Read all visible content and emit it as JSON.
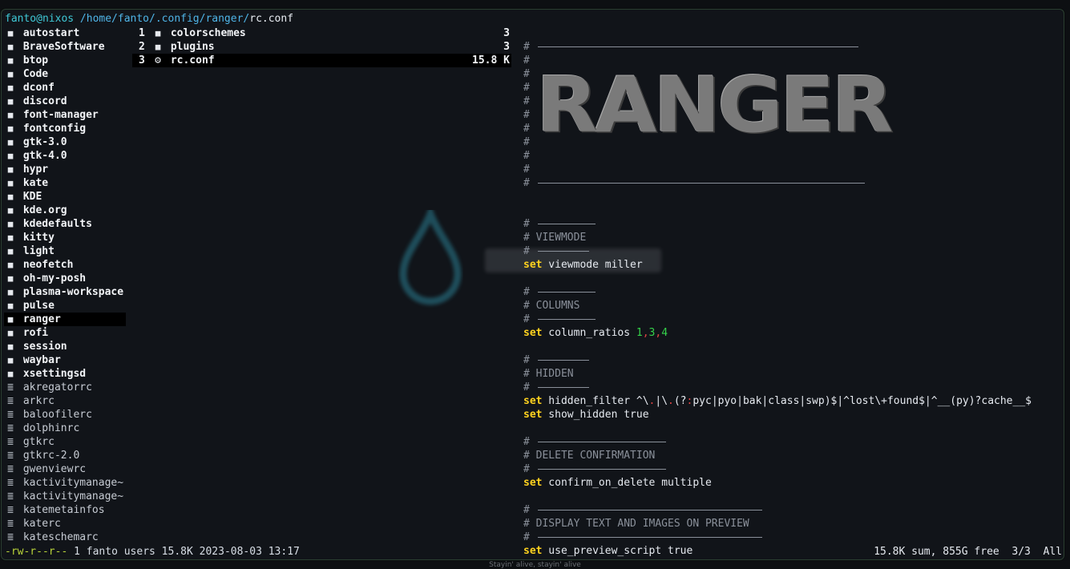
{
  "titlebar": {
    "user_host": "fanto@nixos",
    "path": " /home/fanto/.config/ranger/",
    "file": "rc.conf"
  },
  "parent_column": [
    {
      "type": "dir",
      "name": "autostart"
    },
    {
      "type": "dir",
      "name": "BraveSoftware"
    },
    {
      "type": "dir",
      "name": "btop"
    },
    {
      "type": "dir",
      "name": "Code"
    },
    {
      "type": "dir",
      "name": "dconf"
    },
    {
      "type": "dir",
      "name": "discord"
    },
    {
      "type": "dir",
      "name": "font-manager"
    },
    {
      "type": "dir",
      "name": "fontconfig"
    },
    {
      "type": "dir",
      "name": "gtk-3.0"
    },
    {
      "type": "dir",
      "name": "gtk-4.0"
    },
    {
      "type": "dir",
      "name": "hypr"
    },
    {
      "type": "dir",
      "name": "kate"
    },
    {
      "type": "dir",
      "name": "KDE"
    },
    {
      "type": "dir",
      "name": "kde.org"
    },
    {
      "type": "dir",
      "name": "kdedefaults"
    },
    {
      "type": "dir",
      "name": "kitty"
    },
    {
      "type": "dir",
      "name": "light"
    },
    {
      "type": "dir",
      "name": "neofetch"
    },
    {
      "type": "dir",
      "name": "oh-my-posh"
    },
    {
      "type": "dir",
      "name": "plasma-workspace"
    },
    {
      "type": "dir",
      "name": "pulse"
    },
    {
      "type": "dir",
      "name": "ranger",
      "selected": true
    },
    {
      "type": "dir",
      "name": "rofi"
    },
    {
      "type": "dir",
      "name": "session"
    },
    {
      "type": "dir",
      "name": "waybar"
    },
    {
      "type": "dir",
      "name": "xsettingsd"
    },
    {
      "type": "file",
      "name": "akregatorrc"
    },
    {
      "type": "file",
      "name": "arkrc"
    },
    {
      "type": "file",
      "name": "baloofilerc"
    },
    {
      "type": "file",
      "name": "dolphinrc"
    },
    {
      "type": "file",
      "name": "gtkrc"
    },
    {
      "type": "file",
      "name": "gtkrc-2.0"
    },
    {
      "type": "file",
      "name": "gwenviewrc"
    },
    {
      "type": "file",
      "name": "kactivitymanage~"
    },
    {
      "type": "file",
      "name": "kactivitymanage~"
    },
    {
      "type": "file",
      "name": "katemetainfos"
    },
    {
      "type": "file",
      "name": "katerc"
    },
    {
      "type": "file",
      "name": "kateschemarc"
    }
  ],
  "current_column": [
    {
      "num": "1",
      "type": "dir",
      "name": "colorschemes",
      "size": "3"
    },
    {
      "num": "2",
      "type": "dir",
      "name": "plugins",
      "size": "3"
    },
    {
      "num": "3",
      "type": "conf",
      "name": "rc.conf",
      "size": "15.8 K",
      "selected": true
    }
  ],
  "icons": {
    "dir": "folder-icon",
    "file": "text-file-icon",
    "conf": "gear-icon"
  },
  "preview": {
    "banner": "RANGER",
    "lines": [
      {
        "segments": [
          {
            "c": "cm",
            "t": "# "
          }
        ]
      },
      {
        "segments": [
          {
            "c": "cm",
            "t": "#"
          }
        ]
      },
      {
        "segments": [
          {
            "c": "cm",
            "t": "#"
          }
        ]
      },
      {
        "segments": [
          {
            "c": "cm",
            "t": "#"
          }
        ]
      },
      {
        "segments": [
          {
            "c": "cm",
            "t": "#"
          }
        ]
      },
      {
        "segments": [
          {
            "c": "cm",
            "t": "#"
          }
        ]
      },
      {
        "segments": [
          {
            "c": "cm",
            "t": "#"
          }
        ]
      },
      {
        "segments": [
          {
            "c": "cm",
            "t": "#"
          }
        ]
      },
      {
        "segments": [
          {
            "c": "cm",
            "t": "#"
          }
        ]
      },
      {
        "segments": [
          {
            "c": "cm",
            "t": "#"
          }
        ]
      },
      {
        "segments": [
          {
            "c": "cm",
            "t": "# "
          }
        ]
      },
      {
        "segments": []
      },
      {
        "segments": []
      },
      {
        "segments": [
          {
            "c": "cm",
            "t": "# "
          }
        ]
      },
      {
        "segments": [
          {
            "c": "cm",
            "t": "# VIEWMODE"
          }
        ]
      },
      {
        "segments": [
          {
            "c": "cm",
            "t": "# "
          }
        ]
      },
      {
        "segments": [
          {
            "c": "kw",
            "t": "set"
          },
          {
            "c": "tx",
            "t": " viewmode miller"
          }
        ]
      },
      {
        "segments": []
      },
      {
        "segments": [
          {
            "c": "cm",
            "t": "# "
          }
        ]
      },
      {
        "segments": [
          {
            "c": "cm",
            "t": "# COLUMNS"
          }
        ]
      },
      {
        "segments": [
          {
            "c": "cm",
            "t": "# "
          }
        ]
      },
      {
        "segments": [
          {
            "c": "kw",
            "t": "set"
          },
          {
            "c": "tx",
            "t": " column_ratios "
          },
          {
            "c": "gn",
            "t": "1"
          },
          {
            "c": "rd",
            "t": ","
          },
          {
            "c": "gn",
            "t": "3"
          },
          {
            "c": "rd",
            "t": ","
          },
          {
            "c": "gn",
            "t": "4"
          }
        ]
      },
      {
        "segments": []
      },
      {
        "segments": [
          {
            "c": "cm",
            "t": "# "
          }
        ]
      },
      {
        "segments": [
          {
            "c": "cm",
            "t": "# HIDDEN"
          }
        ]
      },
      {
        "segments": [
          {
            "c": "cm",
            "t": "# "
          }
        ]
      },
      {
        "segments": [
          {
            "c": "kw",
            "t": "set"
          },
          {
            "c": "tx",
            "t": " hidden_filter ^\\"
          },
          {
            "c": "pk",
            "t": "."
          },
          {
            "c": "tx",
            "t": "|\\"
          },
          {
            "c": "pk",
            "t": "."
          },
          {
            "c": "tx",
            "t": "(?"
          },
          {
            "c": "pk",
            "t": ":"
          },
          {
            "c": "tx",
            "t": "pyc|pyo|bak|class|swp)$|^lost\\+found$|^__(py)?cache__$"
          }
        ]
      },
      {
        "segments": [
          {
            "c": "kw",
            "t": "set"
          },
          {
            "c": "tx",
            "t": " show_hidden true"
          }
        ]
      },
      {
        "segments": []
      },
      {
        "segments": [
          {
            "c": "cm",
            "t": "# "
          }
        ]
      },
      {
        "segments": [
          {
            "c": "cm",
            "t": "# DELETE CONFIRMATION"
          }
        ]
      },
      {
        "segments": [
          {
            "c": "cm",
            "t": "# "
          }
        ]
      },
      {
        "segments": [
          {
            "c": "kw",
            "t": "set"
          },
          {
            "c": "tx",
            "t": " confirm_on_delete multiple"
          }
        ]
      },
      {
        "segments": []
      },
      {
        "segments": [
          {
            "c": "cm",
            "t": "# "
          }
        ]
      },
      {
        "segments": [
          {
            "c": "cm",
            "t": "# DISPLAY TEXT AND IMAGES ON PREVIEW"
          }
        ]
      },
      {
        "segments": [
          {
            "c": "cm",
            "t": "# "
          }
        ]
      },
      {
        "segments": [
          {
            "c": "kw",
            "t": "set"
          },
          {
            "c": "tx",
            "t": " use_preview_script true"
          }
        ]
      }
    ]
  },
  "status": {
    "permissions": "-rw-r--r--",
    "details": " 1 fanto users 15.8K 2023-08-03 13:17",
    "right": "15.8K sum, 855G free  3/3  All"
  },
  "footer": "Stayin' alive, stayin' alive",
  "colors": {
    "accent_cyan": "#3fc8d6",
    "keyword_yellow": "#ffd21f",
    "number_green": "#35d24a",
    "perm_green": "#b9d33a"
  }
}
